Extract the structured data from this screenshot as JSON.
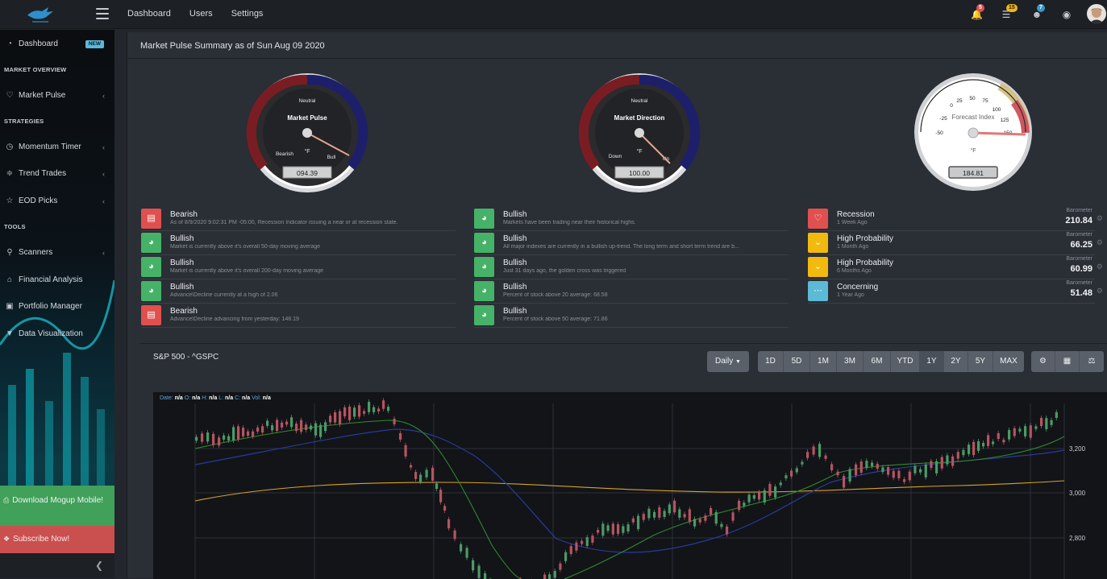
{
  "topbar": {
    "nav": [
      "Dashboard",
      "Users",
      "Settings"
    ],
    "badges": {
      "bell": "5",
      "list": "15",
      "users": "7"
    },
    "colors": {
      "bell": "#e0504e",
      "list": "#f0b41e",
      "users": "#3a97c9"
    }
  },
  "sidebar": {
    "dashboard": "Dashboard",
    "new_badge": "NEW",
    "market_overview": "MARKET OVERVIEW",
    "market_pulse": "Market Pulse",
    "strategies": "STRATEGIES",
    "momentum_timer": "Momentum Timer",
    "trend_trades": "Trend Trades",
    "eod_picks": "EOD Picks",
    "tools": "TOOLS",
    "scanners": "Scanners",
    "financial_analysis": "Financial Analysis",
    "portfolio_manager": "Portfolio Manager",
    "data_visualization": "Data Visualization",
    "download": "Download Mogup Mobile!",
    "subscribe": "Subscribe Now!"
  },
  "main": {
    "title": "Market Pulse Summary as of Sun Aug 09 2020"
  },
  "gauges": {
    "pulse": {
      "title": "Market Pulse",
      "top": "Neutral",
      "left": "Bearish",
      "right": "Bull",
      "unit": "°F",
      "readout": "094.39",
      "level": 94.39
    },
    "direction": {
      "title": "Market Direction",
      "top": "Neutral",
      "left": "Down",
      "right": "Up",
      "unit": "°F",
      "readout": "100.00",
      "level": 100
    },
    "forecast": {
      "title": "Forecast Index",
      "unit": "°F",
      "readout": "184.81",
      "ticks": [
        "-50",
        "-25",
        "0",
        "25",
        "50",
        "75",
        "100",
        "125",
        "150"
      ],
      "level": 184.81
    }
  },
  "signals_left": [
    {
      "title": "Bearish",
      "sub": "As of 8/9/2020 9:02:31 PM -05:00, Recession Indicator issuing a near or at recession state.",
      "type": "bear"
    },
    {
      "title": "Bullish",
      "sub": "Market is currently above it's overall 50-day moving average",
      "type": "bull"
    },
    {
      "title": "Bullish",
      "sub": "Market is currently above it's overall 200-day moving average",
      "type": "bull"
    },
    {
      "title": "Bullish",
      "sub": "Advance\\Decline currently at a high of 2.06",
      "type": "bull"
    },
    {
      "title": "Bearish",
      "sub": "Advance\\Decline advancing from yesterday: 148.19",
      "type": "bear"
    }
  ],
  "signals_mid": [
    {
      "title": "Bullish",
      "sub": "Markets have been trading near their historical highs.",
      "type": "bull"
    },
    {
      "title": "Bullish",
      "sub": "All major indexes are currently in a bullish up-trend. The long term and short term trend are b...",
      "type": "bull"
    },
    {
      "title": "Bullish",
      "sub": "Just 31 days ago, the golden cross was triggered",
      "type": "bull"
    },
    {
      "title": "Bullish",
      "sub": "Percent of stock above 20 average: 68.58",
      "type": "bull"
    },
    {
      "title": "Bullish",
      "sub": "Percent of stock above 50 average: 71.86",
      "type": "bull"
    }
  ],
  "signals_right": [
    {
      "title": "Recession",
      "sub": "1 Week Ago",
      "label": "Barometer",
      "value": "210.84",
      "type": "rec"
    },
    {
      "title": "High Probability",
      "sub": "1 Month Ago",
      "label": "Barometer",
      "value": "66.25",
      "type": "high"
    },
    {
      "title": "High Probability",
      "sub": "6 Months Ago",
      "label": "Barometer",
      "value": "60.99",
      "type": "high"
    },
    {
      "title": "Concerning",
      "sub": "1 Year Ago",
      "label": "Barometer",
      "value": "51.48",
      "type": "con"
    }
  ],
  "colors": {
    "bull": "#45b267",
    "bear": "#e0504e",
    "rec": "#e0504e",
    "high": "#f2b90f",
    "con": "#5bbad6"
  },
  "chart": {
    "title": "S&P 500 - ^GSPC",
    "interval": "Daily",
    "ranges": [
      "1D",
      "5D",
      "1M",
      "3M",
      "6M",
      "YTD",
      "1Y",
      "2Y",
      "5Y",
      "MAX"
    ],
    "active_range": "1Y",
    "legend": {
      "date_label": "Date:",
      "o_label": "O:",
      "h_label": "H:",
      "l_label": "L:",
      "c_label": "C:",
      "vol_label": "Vol:",
      "value": "n/a"
    },
    "y_labels": [
      "3,200",
      "3,000",
      "2,800"
    ]
  }
}
